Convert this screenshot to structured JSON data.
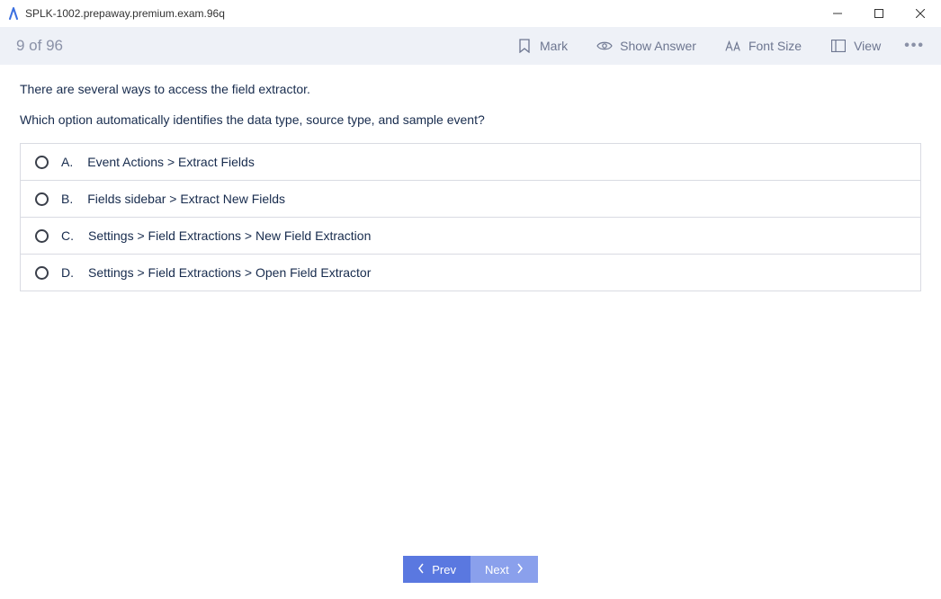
{
  "window": {
    "title": "SPLK-1002.prepaway.premium.exam.96q"
  },
  "toolbar": {
    "progress": "9 of 96",
    "mark_label": "Mark",
    "show_answer_label": "Show Answer",
    "font_size_label": "Font Size",
    "view_label": "View",
    "more_glyph": "•••"
  },
  "question": {
    "line1": "There are several ways to access the field extractor.",
    "line2": "Which option automatically identifies the data type, source type, and sample event?"
  },
  "options": [
    {
      "letter": "A.",
      "text": "Event Actions > Extract Fields"
    },
    {
      "letter": "B.",
      "text": "Fields sidebar > Extract New Fields"
    },
    {
      "letter": "C.",
      "text": "Settings > Field Extractions > New Field Extraction"
    },
    {
      "letter": "D.",
      "text": "Settings > Field Extractions > Open Field Extractor"
    }
  ],
  "nav": {
    "prev_label": "Prev",
    "next_label": "Next"
  }
}
